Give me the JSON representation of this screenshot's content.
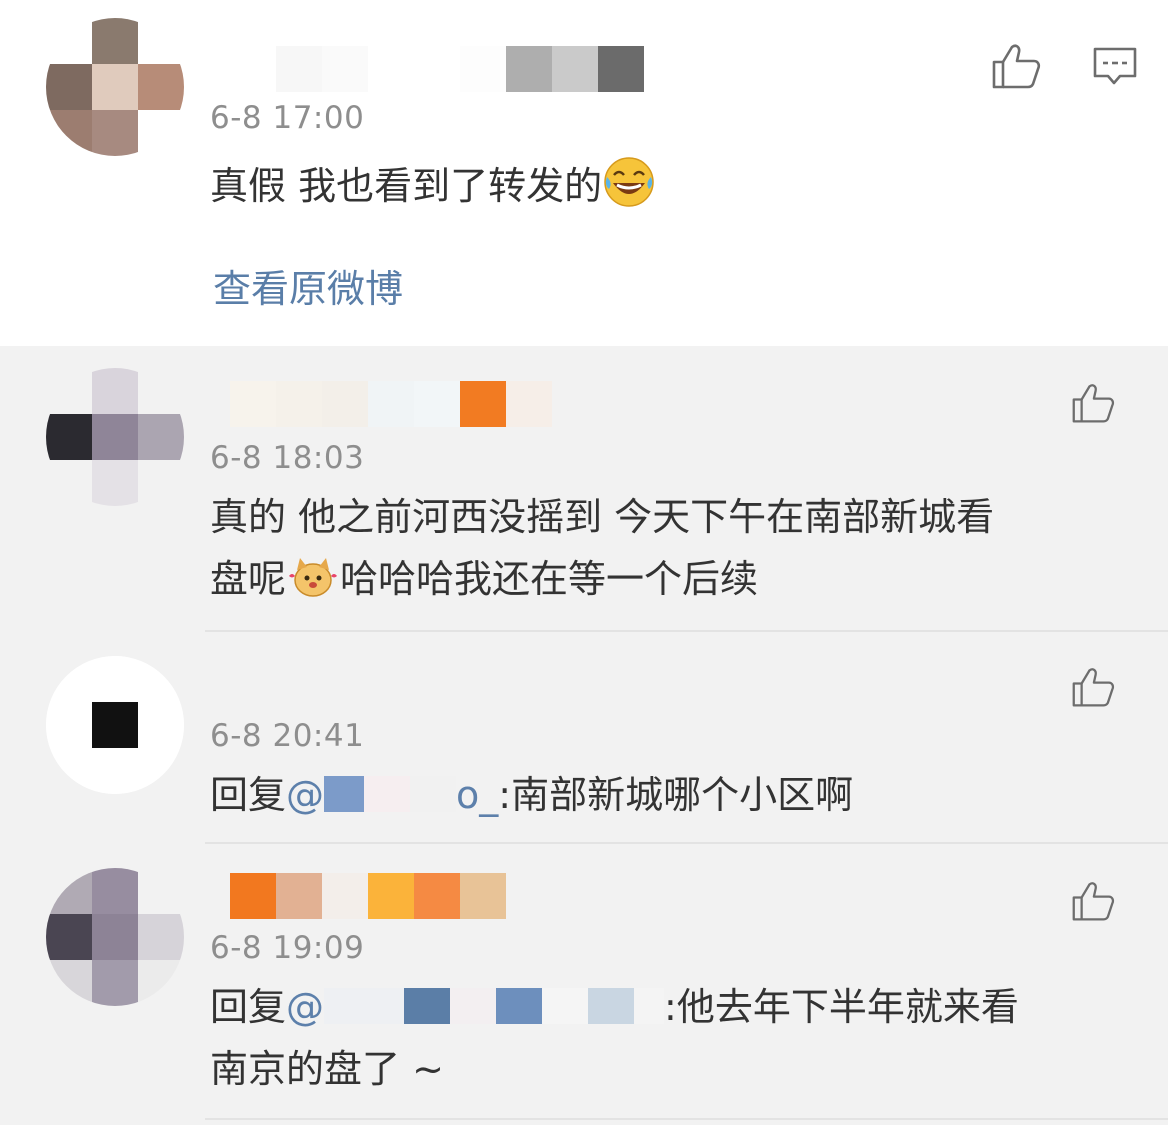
{
  "top_comment": {
    "time": "6-8 17:00",
    "text": "真假 我也看到了转发的",
    "emoji": "laughing-tears-icon",
    "view_original": "查看原微博"
  },
  "replies": [
    {
      "time": "6-8 18:03",
      "text_line1": "真的 他之前河西没摇到 今天下午在南部新城看",
      "text_line2_a": "盘呢",
      "text_line2_b": "哈哈哈我还在等一个后续",
      "emoji": "cute-dog-icon"
    },
    {
      "time": "6-8 20:41",
      "prefix": "回复",
      "mention_start": "@",
      "mention_end": "o_",
      "text": ":南部新城哪个小区啊"
    },
    {
      "time": "6-8 19:09",
      "prefix": "回复",
      "mention_start": "@",
      "text_line1": ":他去年下半年就来看",
      "text_line2": "南京的盘了 ~"
    }
  ],
  "colors": {
    "link": "#5a7ea8",
    "time": "#8e8e8e",
    "reply_bg": "#f2f2f2",
    "card_bg": "#ffffff"
  }
}
